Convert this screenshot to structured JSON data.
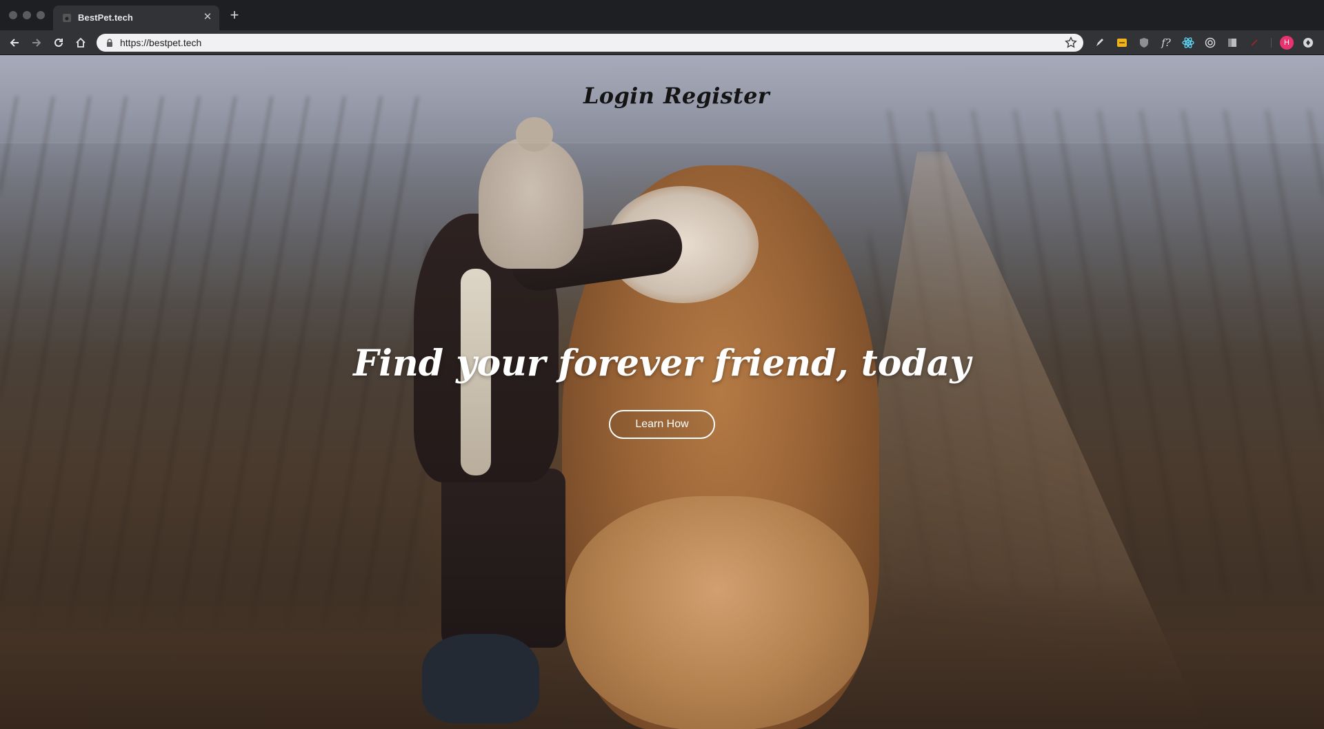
{
  "browser": {
    "tab_title": "BestPet.tech",
    "url": "https://bestpet.tech",
    "profile_initial": "H",
    "colors": {
      "tabbar": "#1e1f22",
      "toolbar": "#323337",
      "omnibox": "#f1f1f3",
      "profile": "#e8336e"
    }
  },
  "page": {
    "nav": {
      "login_label": "Login",
      "register_label": "Register"
    },
    "hero": {
      "title": "Find your forever friend, today",
      "cta_label": "Learn How"
    }
  }
}
